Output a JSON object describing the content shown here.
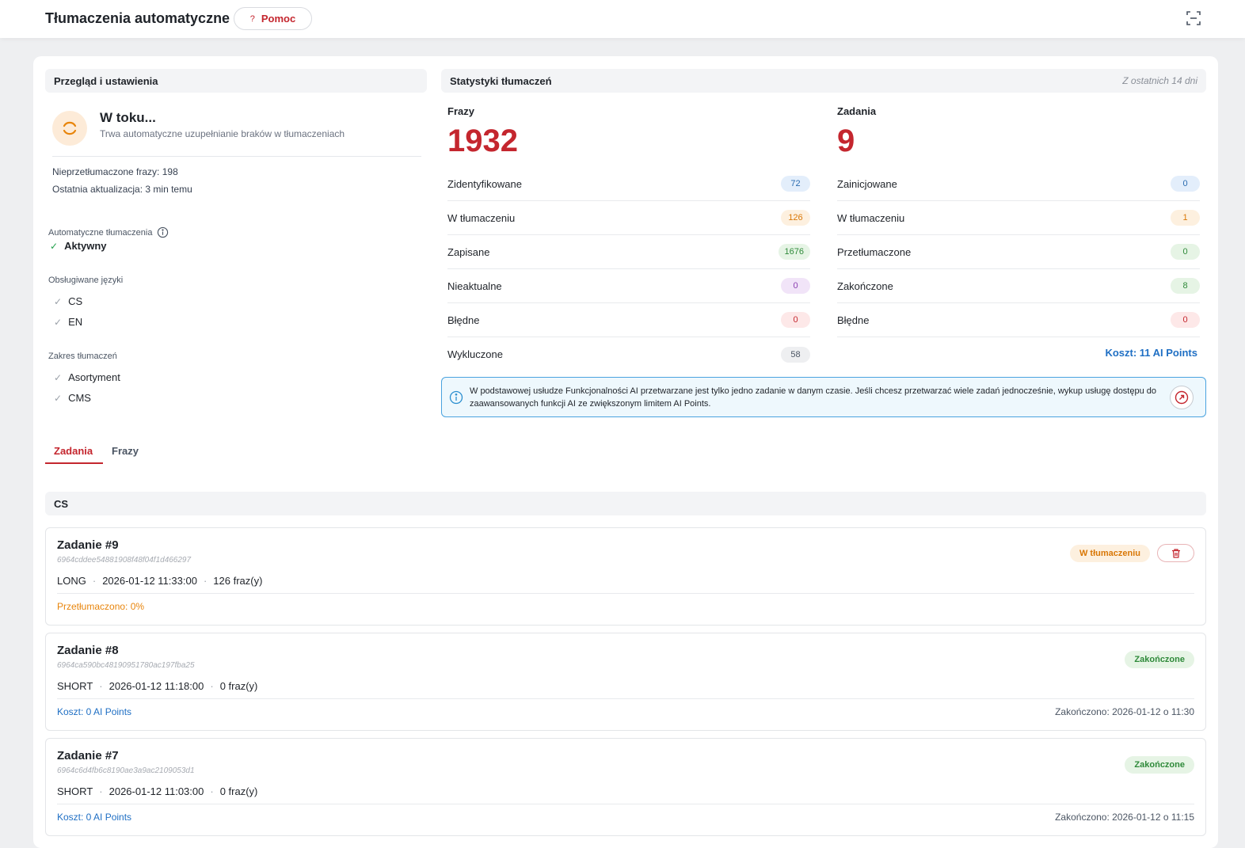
{
  "topbar": {
    "title": "Tłumaczenia automatyczne",
    "help_label": "Pomoc",
    "help_icon": "?"
  },
  "overview": {
    "header": "Przegląd i ustawienia",
    "status_title": "W toku...",
    "status_subtitle": "Trwa automatyczne uzupełnianie braków w tłumaczeniach",
    "untranslated": "Nieprzetłumaczone frazy: 198",
    "last_update": "Ostatnia aktualizacja: 3 min temu",
    "auto_label": "Automatyczne tłumaczenia",
    "auto_value": "Aktywny",
    "languages_label": "Obsługiwane języki",
    "languages": [
      "CS",
      "EN"
    ],
    "scope_label": "Zakres tłumaczeń",
    "scope": [
      "Asortyment",
      "CMS"
    ]
  },
  "stats": {
    "header": "Statystyki tłumaczeń",
    "period": "Z ostatnich 14 dni",
    "phrases": {
      "title": "Frazy",
      "total": "1932",
      "rows": [
        {
          "label": "Zidentyfikowane",
          "value": "72",
          "color": "blue"
        },
        {
          "label": "W tłumaczeniu",
          "value": "126",
          "color": "orange"
        },
        {
          "label": "Zapisane",
          "value": "1676",
          "color": "green"
        },
        {
          "label": "Nieaktualne",
          "value": "0",
          "color": "purple"
        },
        {
          "label": "Błędne",
          "value": "0",
          "color": "red"
        },
        {
          "label": "Wykluczone",
          "value": "58",
          "color": "gray"
        }
      ]
    },
    "tasks": {
      "title": "Zadania",
      "total": "9",
      "rows": [
        {
          "label": "Zainicjowane",
          "value": "0",
          "color": "blue"
        },
        {
          "label": "W tłumaczeniu",
          "value": "1",
          "color": "orange"
        },
        {
          "label": "Przetłumaczone",
          "value": "0",
          "color": "green"
        },
        {
          "label": "Zakończone",
          "value": "8",
          "color": "green"
        },
        {
          "label": "Błędne",
          "value": "0",
          "color": "red"
        }
      ],
      "cost": "Koszt: 11 AI Points"
    },
    "info": "W podstawowej usłudze Funkcjonalności AI przetwarzane jest tylko jedno zadanie w danym czasie. Jeśli chcesz przetwarzać wiele zadań jednocześnie, wykup usługę dostępu do zaawansowanych funkcji AI ze zwiększonym limitem AI Points."
  },
  "tabs": [
    "Zadania",
    "Frazy"
  ],
  "language_group": "CS",
  "tasks": [
    {
      "title": "Zadanie #9",
      "hash": "6964cddee54881908f48f04f1d466297",
      "type": "LONG",
      "date": "2026-01-12 11:33:00",
      "count": "126 fraz(y)",
      "status": "W tłumaczeniu",
      "progress": "Przetłumaczono: 0%"
    },
    {
      "title": "Zadanie #8",
      "hash": "6964ca590bc48190951780ac197fba25",
      "type": "SHORT",
      "date": "2026-01-12 11:18:00",
      "count": "0 fraz(y)",
      "status": "Zakończone",
      "cost": "Koszt: 0 AI Points",
      "finished": "Zakończono: 2026-01-12 o 11:30"
    },
    {
      "title": "Zadanie #7",
      "hash": "6964c6d4fb6c8190ae3a9ac2109053d1",
      "type": "SHORT",
      "date": "2026-01-12 11:03:00",
      "count": "0 fraz(y)",
      "status": "Zakończone",
      "cost": "Koszt: 0 AI Points",
      "finished": "Zakończono: 2026-01-12 o 11:15"
    }
  ],
  "colors": {
    "accent": "#c4262e",
    "link": "#1f6fc4",
    "progress": "#e8850c",
    "info_border": "#4aa3df"
  }
}
